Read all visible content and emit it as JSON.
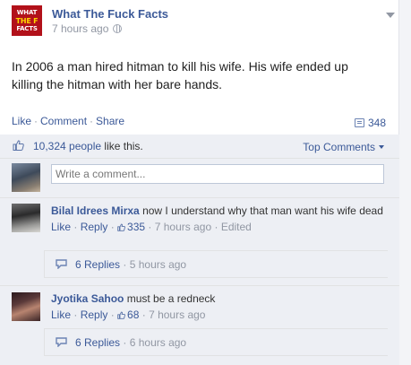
{
  "post": {
    "page_name": "What The Fuck Facts",
    "logo_lines": [
      "WHAT",
      "THE F",
      "FACTS"
    ],
    "time": "7 hours ago",
    "text": "In 2006 a man hired hitman to kill his wife. His wife ended up killing the hitman with her bare hands.",
    "actions": {
      "like": "Like",
      "comment": "Comment",
      "share": "Share",
      "sep": "·"
    },
    "share_count": "348"
  },
  "ufi": {
    "likes_count": "10,324 people",
    "likes_suffix": "like this.",
    "top_comments": "Top Comments",
    "write_placeholder": "Write a comment..."
  },
  "comments": [
    {
      "author": "Bilal Idrees Mirxa",
      "text": "now I understand why that man want his wife dead",
      "like": "Like",
      "reply": "Reply",
      "likes": "335",
      "time": "7 hours ago",
      "edited": "Edited",
      "replies_label": "6 Replies",
      "replies_time": "5 hours ago"
    },
    {
      "author": "Jyotika Sahoo",
      "text": "must be a redneck",
      "like": "Like",
      "reply": "Reply",
      "likes": "68",
      "time": "7 hours ago",
      "edited": "",
      "replies_label": "6 Replies",
      "replies_time": "6 hours ago"
    }
  ],
  "colors": {
    "link": "#3b5998",
    "muted": "#9197a3",
    "ufi_bg": "#edeff4",
    "logo_bg": "#b2111a"
  },
  "icons": [
    "globe-icon",
    "chevron-down-icon",
    "share-icon",
    "thumbs-up-icon",
    "reply-icon"
  ]
}
